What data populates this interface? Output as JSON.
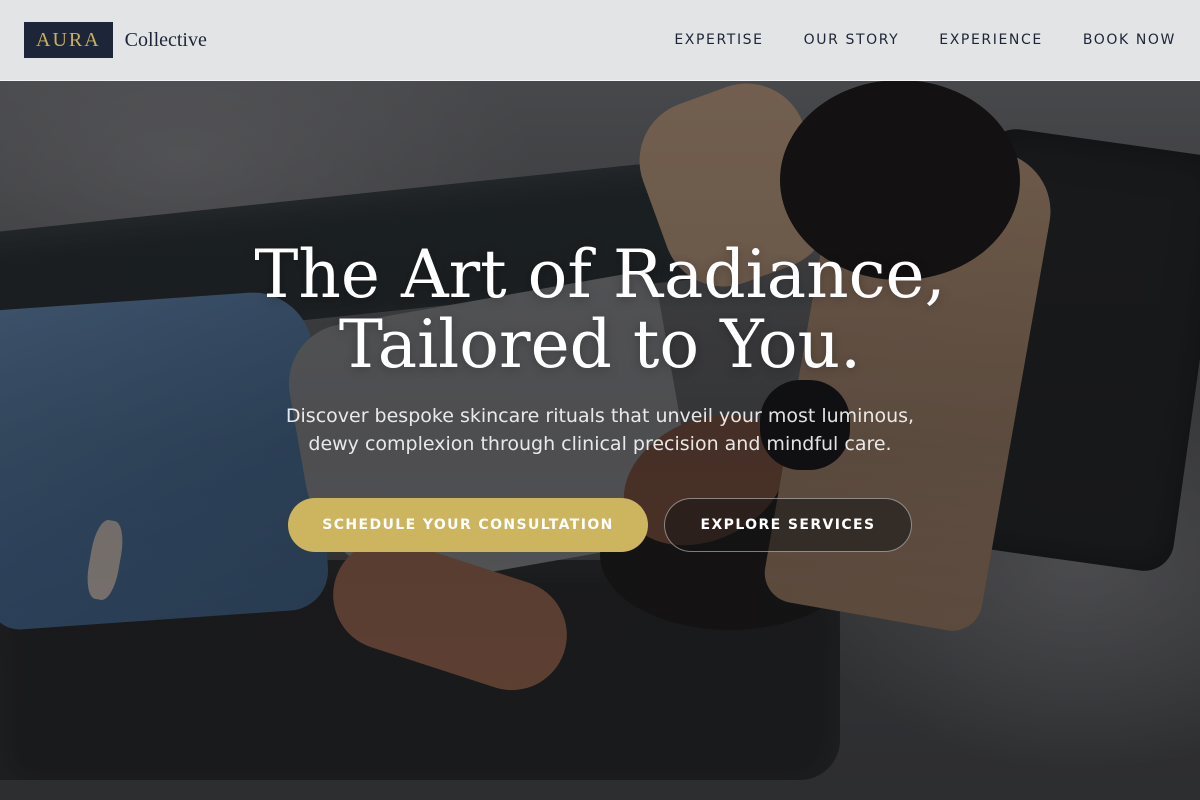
{
  "brand": {
    "mark": "AURA",
    "word": "Collective",
    "mark_bg": "#1d2638",
    "mark_color": "#c9b05c"
  },
  "nav": {
    "items": [
      {
        "label": "EXPERTISE"
      },
      {
        "label": "OUR STORY"
      },
      {
        "label": "EXPERIENCE"
      },
      {
        "label": "BOOK NOW"
      }
    ]
  },
  "hero": {
    "headline_line1": "The Art of Radiance,",
    "headline_line2": "Tailored to You.",
    "subtext": "Discover bespoke skincare rituals that unveil your most luminous, dewy complexion through clinical precision and mindful care.",
    "primary_cta": "SCHEDULE YOUR CONSULTATION",
    "secondary_cta": "EXPLORE SERVICES"
  },
  "colors": {
    "accent_gold": "#cdb45e",
    "navy": "#1d2638"
  }
}
